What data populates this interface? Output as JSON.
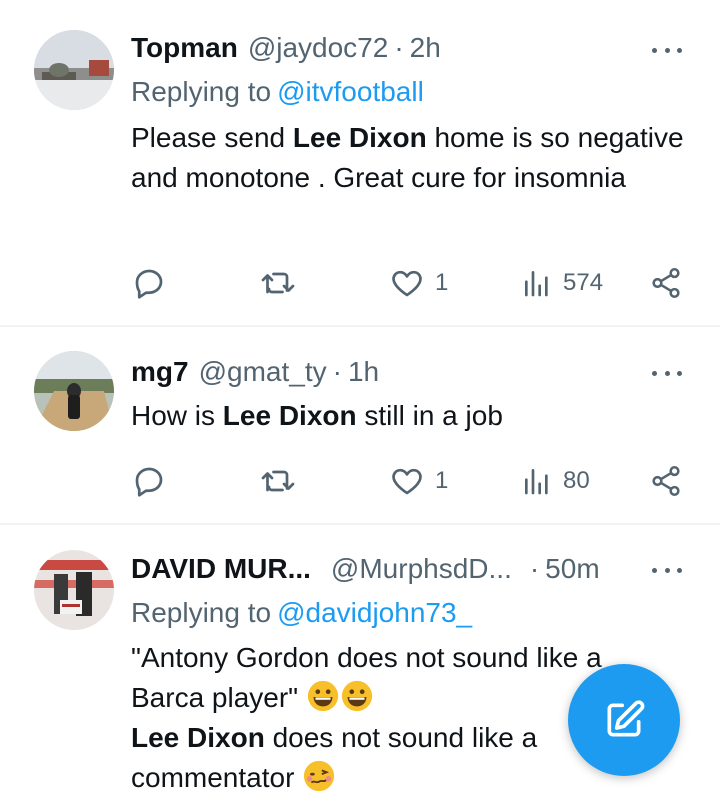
{
  "tweets": [
    {
      "display_name": "Topman",
      "handle": "@jaydoc72",
      "dot": "·",
      "time": "2h",
      "replying_prefix": "Replying to",
      "replying_to": "@itvfootball",
      "body": {
        "t1": "Please send ",
        "b1": "Lee Dixon",
        "t2": " home is so negative and monotone . Great cure for insomnia"
      },
      "stats": {
        "likes": "1",
        "views": "574"
      }
    },
    {
      "display_name": "mg7",
      "handle": "@gmat_ty",
      "dot": "·",
      "time": "1h",
      "body": {
        "t1": "How is ",
        "b1": "Lee Dixon",
        "t2": " still in a job"
      },
      "stats": {
        "likes": "1",
        "views": "80"
      }
    },
    {
      "display_name": "DAVID MUR...",
      "handle": "@MurphsdD...",
      "dot": "·",
      "time": "50m",
      "replying_prefix": "Replying to",
      "replying_to": "@davidjohn73_",
      "body": {
        "line1": "\"Antony Gordon does not sound like a",
        "line2": "Barca player\"",
        "b1": "Lee Dixon",
        "t3": " does not sound like a",
        "line4": "commentator"
      }
    }
  ],
  "colors": {
    "accent": "#1d9bf0",
    "secondary_text": "#536471",
    "separator": "#eff3f4"
  },
  "icons": {
    "reply": "reply-icon",
    "retweet": "retweet-icon",
    "like": "heart-icon",
    "views": "views-icon",
    "share": "share-icon",
    "compose": "compose-icon"
  }
}
